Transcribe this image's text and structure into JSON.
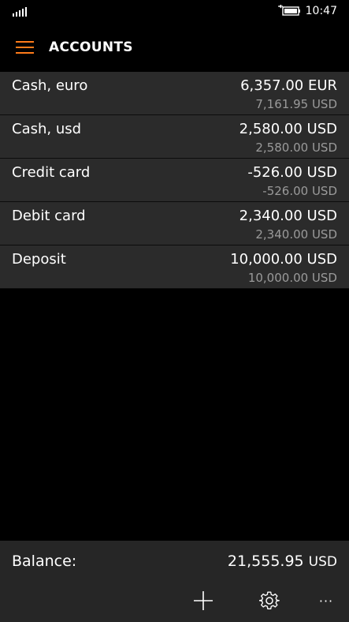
{
  "status_bar": {
    "time": "10:47",
    "icons": [
      "signal-icon",
      "battery-charging-icon"
    ]
  },
  "header": {
    "title": "ACCOUNTS",
    "menu_icon": "hamburger-menu-icon",
    "accent_color": "#ff7b1a"
  },
  "accounts": [
    {
      "name": "Cash, euro",
      "amount": "6,357.00 EUR",
      "amount_usd": "7,161.95 USD"
    },
    {
      "name": "Cash, usd",
      "amount": "2,580.00 USD",
      "amount_usd": "2,580.00 USD"
    },
    {
      "name": "Credit card",
      "amount": "-526.00 USD",
      "amount_usd": "-526.00 USD"
    },
    {
      "name": "Debit card",
      "amount": "2,340.00 USD",
      "amount_usd": "2,340.00 USD"
    },
    {
      "name": "Deposit",
      "amount": "10,000.00 USD",
      "amount_usd": "10,000.00 USD"
    }
  ],
  "footer": {
    "balance_label": "Balance:",
    "balance_value": "21,555.95",
    "balance_currency": "USD",
    "toolbar": {
      "add_icon": "plus-icon",
      "settings_icon": "gear-icon",
      "more_icon": "more-ellipsis-icon",
      "more_label": "···"
    }
  }
}
